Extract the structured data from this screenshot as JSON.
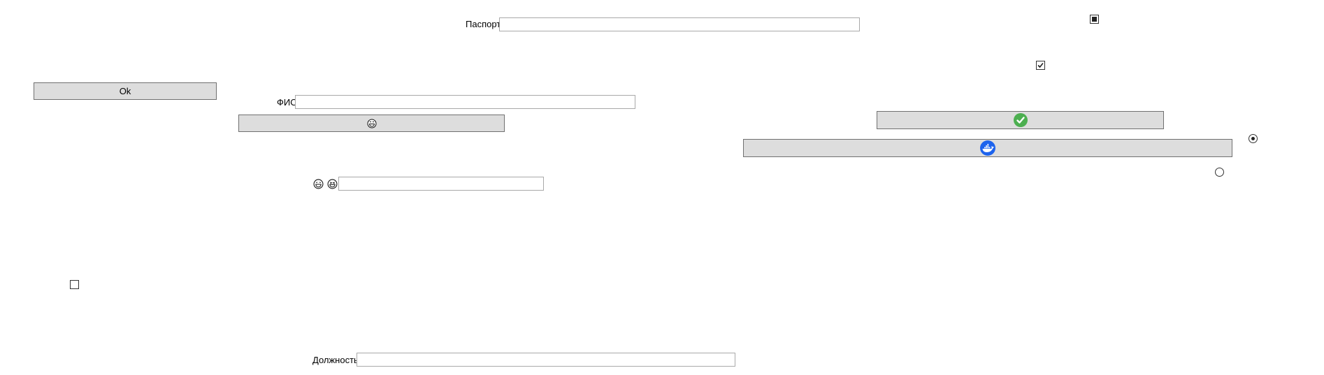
{
  "labels": {
    "passport": "Паспорт",
    "fio": "ФИО",
    "position": "Должность"
  },
  "inputs": {
    "passport_value": "",
    "fio_value": "",
    "emoji_value": "",
    "position_value": ""
  },
  "buttons": {
    "ok_label": "Ok",
    "emoji_button_icon": "grinning-face-icon",
    "check_button_icon": "green-check-circle-icon",
    "docker_button_icon": "docker-whale-icon"
  },
  "checkboxes": {
    "top_right_state": "indeterminate",
    "middle_right_state": "checked",
    "left_state": "unchecked"
  },
  "radios": {
    "upper_selected": true,
    "lower_selected": false
  },
  "colors": {
    "button_bg": "#dddddd",
    "button_border": "#707070",
    "textbox_border": "#a9a9a9",
    "check_green": "#4caf50",
    "docker_blue": "#1d63ed"
  }
}
